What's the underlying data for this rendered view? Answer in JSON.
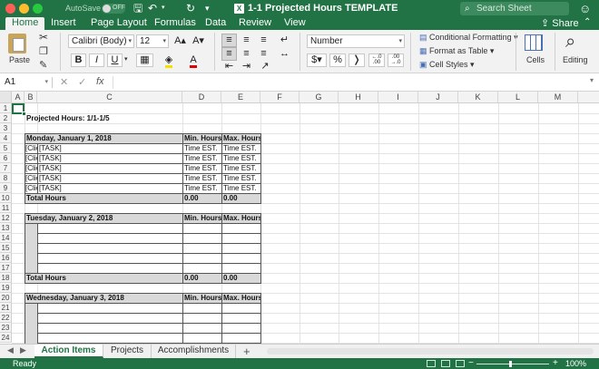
{
  "titlebar": {
    "autosave_label": "AutoSave",
    "autosave_state": "OFF",
    "doc_title": "1-1 Projected Hours TEMPLATE",
    "search_placeholder": "Search Sheet"
  },
  "tabs": [
    "Home",
    "Insert",
    "Page Layout",
    "Formulas",
    "Data",
    "Review",
    "View"
  ],
  "share_label": "Share",
  "ribbon": {
    "paste_label": "Paste",
    "font_name": "Calibri (Body)",
    "font_size": "12",
    "bold": "B",
    "italic": "I",
    "underline": "U",
    "number_format": "Number",
    "currency": "$",
    "percent": "%",
    "comma": "‹",
    "inc_dec": "←.0 .00",
    "dec_dec": ".00 →.0",
    "conditional_formatting": "Conditional Formatting",
    "format_as_table": "Format as Table",
    "cell_styles": "Cell Styles",
    "cells_label": "Cells",
    "editing_label": "Editing"
  },
  "formula_bar": {
    "name_box": "A1",
    "fx": "fx",
    "content": ""
  },
  "columns": [
    "A",
    "B",
    "C",
    "D",
    "E",
    "F",
    "G",
    "H",
    "I",
    "J",
    "K",
    "L",
    "M"
  ],
  "rows": [
    "1",
    "2",
    "3",
    "4",
    "5",
    "6",
    "7",
    "8",
    "9",
    "10",
    "11",
    "12",
    "13",
    "14",
    "15",
    "16",
    "17",
    "18",
    "19",
    "20",
    "21",
    "22",
    "23",
    "24"
  ],
  "sheet": {
    "projected_hours": "Projected Hours: 1/1-1/5",
    "day1": "Monday, January 1, 2018",
    "day2": "Tuesday, January 2, 2018",
    "day3": "Wednesday, January 3, 2018",
    "min_hours": "Min. Hours",
    "max_hours": "Max. Hours",
    "client_short": "[Clie",
    "task": "[TASK]",
    "time_est": "Time EST.",
    "total_hours": "Total Hours",
    "zero": "0.00"
  },
  "sheet_tabs": [
    "Action Items",
    "Projects",
    "Accomplishments"
  ],
  "add_sheet": "+",
  "status": {
    "ready": "Ready",
    "zoom_minus": "−",
    "zoom_plus": "+",
    "zoom": "100%"
  },
  "colors": {
    "excel_green": "#217346",
    "header_band": "#d9d9d9"
  }
}
